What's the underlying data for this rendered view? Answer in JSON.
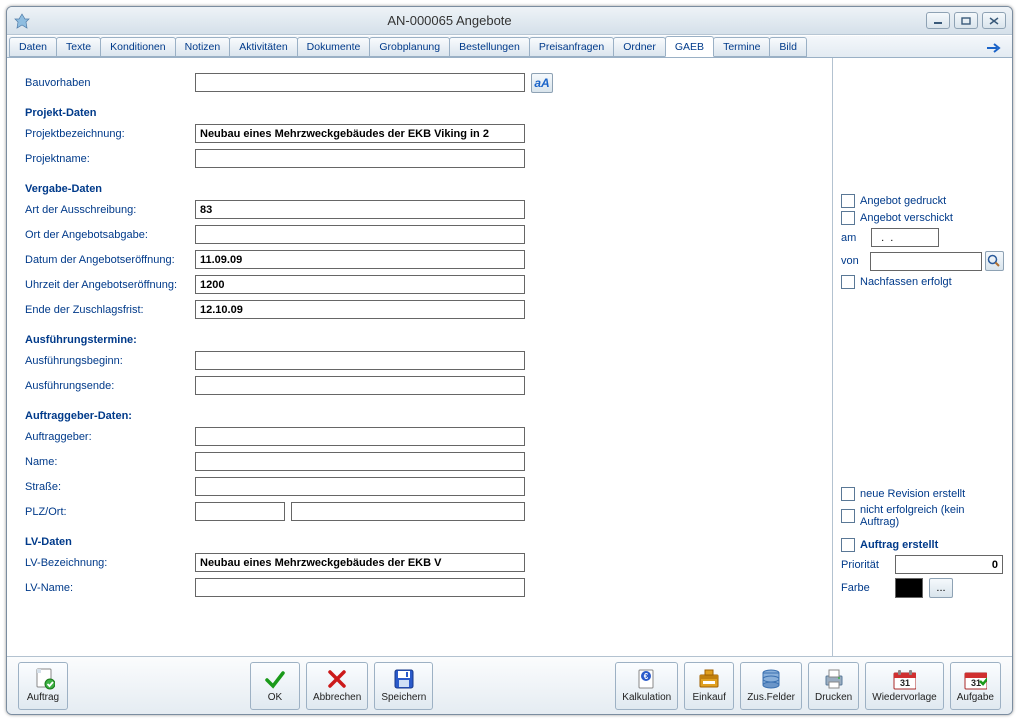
{
  "title": "AN-000065 Angebote",
  "tabs": [
    "Daten",
    "Texte",
    "Konditionen",
    "Notizen",
    "Aktivitäten",
    "Dokumente",
    "Grobplanung",
    "Bestellungen",
    "Preisanfragen",
    "Ordner",
    "GAEB",
    "Termine",
    "Bild"
  ],
  "active_tab": 10,
  "form": {
    "bauvorhaben_label": "Bauvorhaben",
    "bauvorhaben_value": "",
    "projekt_daten_header": "Projekt-Daten",
    "projektbezeichnung_label": "Projektbezeichnung:",
    "projektbezeichnung_value": "Neubau eines Mehrzweckgebäudes der EKB Viking in 2",
    "projektname_label": "Projektname:",
    "projektname_value": "",
    "vergabe_daten_header": "Vergabe-Daten",
    "art_ausschreibung_label": "Art der Ausschreibung:",
    "art_ausschreibung_value": "83",
    "ort_abgabe_label": "Ort der Angebotsabgabe:",
    "ort_abgabe_value": "",
    "datum_eroeffnung_label": "Datum der Angebotseröffnung:",
    "datum_eroeffnung_value": "11.09.09",
    "uhrzeit_eroeffnung_label": "Uhrzeit der Angebotseröffnung:",
    "uhrzeit_eroeffnung_value": "1200",
    "ende_zuschlagsfrist_label": "Ende der Zuschlagsfrist:",
    "ende_zuschlagsfrist_value": "12.10.09",
    "ausfuehrungstermine_header": "Ausführungstermine:",
    "ausfuehrungsbeginn_label": "Ausführungsbeginn:",
    "ausfuehrungsbeginn_value": "",
    "ausfuehrungsende_label": "Ausführungsende:",
    "ausfuehrungsende_value": "",
    "auftraggeber_daten_header": "Auftraggeber-Daten:",
    "auftraggeber_label": "Auftraggeber:",
    "auftraggeber_value": "",
    "name_label": "Name:",
    "name_value": "",
    "strasse_label": "Straße:",
    "strasse_value": "",
    "plzort_label": "PLZ/Ort:",
    "plz_value": "",
    "ort_value": "",
    "lv_daten_header": "LV-Daten",
    "lv_bezeichnung_label": "LV-Bezeichnung:",
    "lv_bezeichnung_value": "Neubau eines Mehrzweckgebäudes der EKB V",
    "lv_name_label": "LV-Name:",
    "lv_name_value": ""
  },
  "side": {
    "angebot_gedruckt_label": "Angebot gedruckt",
    "angebot_verschickt_label": "Angebot verschickt",
    "am_label": "am",
    "am_value": "  .  .",
    "von_label": "von",
    "von_value": "",
    "nachfassen_label": "Nachfassen erfolgt",
    "neue_revision_label": "neue Revision erstellt",
    "nicht_erfolgreich_label": "nicht erfolgreich (kein Auftrag)",
    "auftrag_erstellt_label": "Auftrag erstellt",
    "prioritaet_label": "Priorität",
    "prioritaet_value": "0",
    "farbe_label": "Farbe",
    "farbe_value": "#000000",
    "dots": "..."
  },
  "bottom": [
    {
      "key": "auftrag",
      "label": "Auftrag"
    },
    {
      "key": "ok",
      "label": "OK"
    },
    {
      "key": "abbrechen",
      "label": "Abbrechen"
    },
    {
      "key": "speichern",
      "label": "Speichern"
    },
    {
      "key": "kalkulation",
      "label": "Kalkulation"
    },
    {
      "key": "einkauf",
      "label": "Einkauf"
    },
    {
      "key": "zusfelder",
      "label": "Zus.Felder"
    },
    {
      "key": "drucken",
      "label": "Drucken"
    },
    {
      "key": "wiedervorlage",
      "label": "Wiedervorlage"
    },
    {
      "key": "aufgabe",
      "label": "Aufgabe"
    }
  ]
}
